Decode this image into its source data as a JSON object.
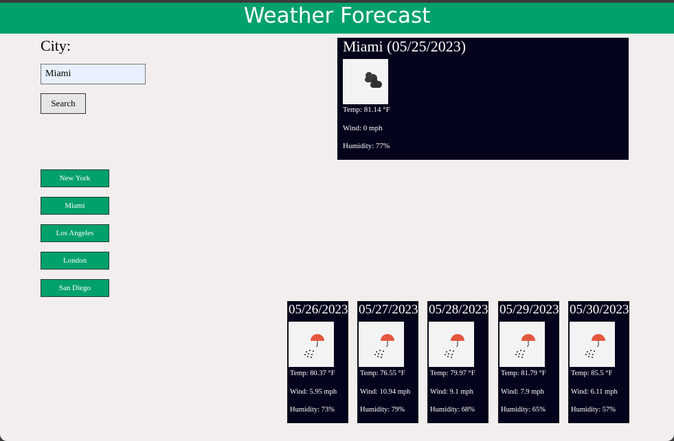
{
  "header": {
    "title": "Weather Forecast"
  },
  "search": {
    "label": "City:",
    "value": "Miami",
    "button_label": "Search"
  },
  "history": [
    "New York",
    "Miami",
    "Los Angeles",
    "London",
    "San Diego"
  ],
  "current": {
    "title": "Miami (05/25/2023)",
    "icon": "clouds-icon",
    "temp": "Temp: 81.14 °F",
    "wind": "Wind: 0 mph",
    "humidity": "Humidity: 77%"
  },
  "forecast": [
    {
      "date": "05/26/2023",
      "icon": "rain-icon",
      "temp": "Temp: 80.37 °F",
      "wind": "Wind: 5.95 mph",
      "humidity": "Humidity: 73%"
    },
    {
      "date": "05/27/2023",
      "icon": "rain-icon",
      "temp": "Temp: 76.55 °F",
      "wind": "Wind: 10.94 mph",
      "humidity": "Humidity: 79%"
    },
    {
      "date": "05/28/2023",
      "icon": "rain-icon",
      "temp": "Temp: 79.97 °F",
      "wind": "Wind: 9.1 mph",
      "humidity": "Humidity: 68%"
    },
    {
      "date": "05/29/2023",
      "icon": "rain-icon",
      "temp": "Temp: 81.79 °F",
      "wind": "Wind: 7.9 mph",
      "humidity": "Humidity: 65%"
    },
    {
      "date": "05/30/2023",
      "icon": "rain-icon",
      "temp": "Temp: 85.5 °F",
      "wind": "Wind: 6.11 mph",
      "humidity": "Humidity: 57%"
    }
  ],
  "colors": {
    "accent": "#01a16c",
    "card_background": "#03031c",
    "page_background": "#f3eeee"
  }
}
